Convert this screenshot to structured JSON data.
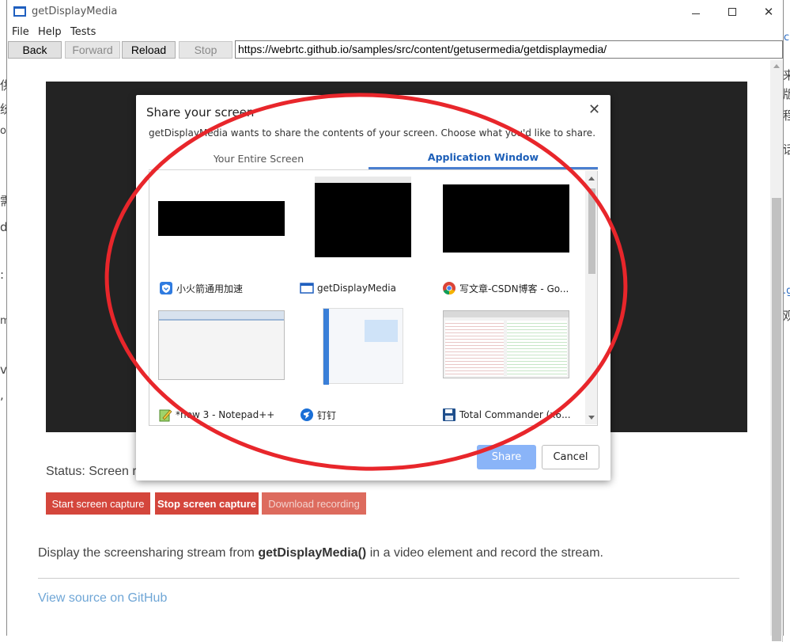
{
  "window": {
    "title": "getDisplayMedia",
    "menu": [
      "File",
      "Help",
      "Tests"
    ],
    "buttons": {
      "back": "Back",
      "forward": "Forward",
      "reload": "Reload",
      "stop": "Stop"
    },
    "url": "https://webrtc.github.io/samples/src/content/getusermedia/getdisplaymedia/"
  },
  "page": {
    "status": "Status: Screen re",
    "buttons": {
      "start": "Start screen capture",
      "stop": "Stop screen capture",
      "download": "Download recording"
    },
    "description_prefix": "Display the screensharing stream from ",
    "description_code": "getDisplayMedia()",
    "description_suffix": " in a video element and record the stream.",
    "source_link": "View source on GitHub"
  },
  "dialog": {
    "title": "Share your screen",
    "subtitle": "getDisplayMedia wants to share the contents of your screen. Choose what you'd like to share.",
    "tabs": [
      "Your Entire Screen",
      "Application Window"
    ],
    "active_tab": "Application Window",
    "windows": [
      {
        "label": "小火箭通用加速",
        "icon": "shield-icon"
      },
      {
        "label": "getDisplayMedia",
        "icon": "window-icon"
      },
      {
        "label": "写文章-CSDN博客 - Go...",
        "icon": "chrome-icon"
      },
      {
        "label": "*new 3 - Notepad++",
        "icon": "notepad-icon"
      },
      {
        "label": "钉钉",
        "icon": "dingtalk-icon"
      },
      {
        "label": "Total Commander (x6...",
        "icon": "floppy-icon"
      }
    ],
    "share_label": "Share",
    "cancel_label": "Cancel"
  },
  "annotation_color": "#e8262b",
  "colors": {
    "accent": "#1d5fb8",
    "page_button": "#d4463c",
    "share_disabled": "#8ab4f8",
    "link": "#6fa6d6"
  }
}
